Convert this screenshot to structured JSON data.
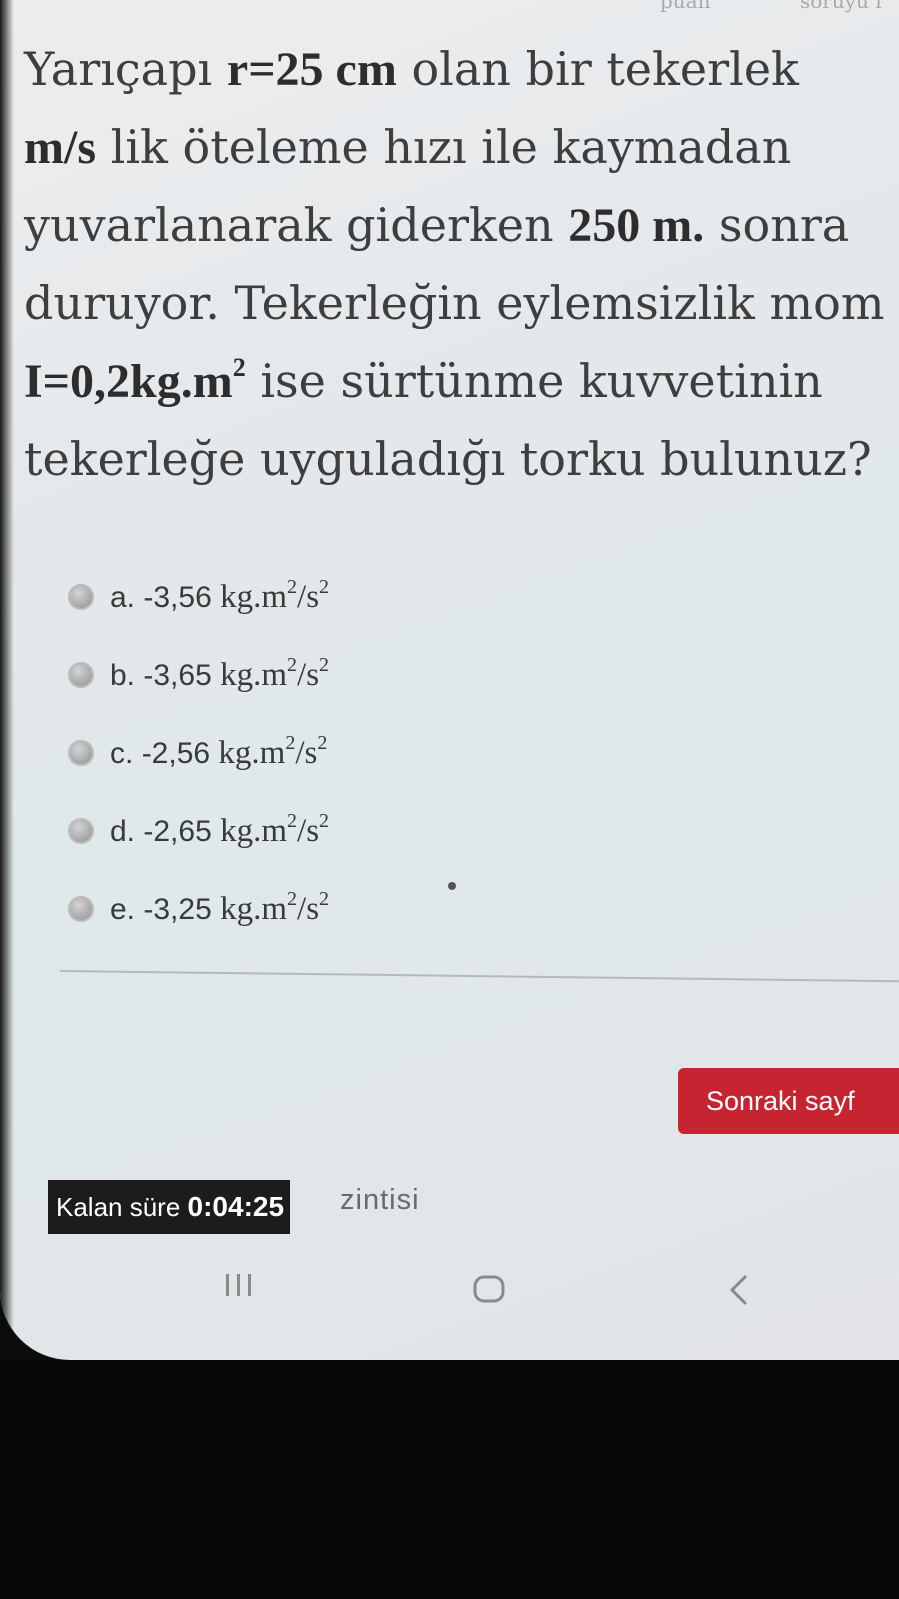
{
  "top_strip": {
    "left_fragment": "...",
    "points_fragment": "puan",
    "question_fragment": "soruyu i"
  },
  "question": {
    "line1_a": "Yarıçapı ",
    "line1_b": "r=25 cm",
    "line1_c": " olan bir tekerlek",
    "line2_a": "m/s",
    "line2_b": " lik öteleme hızı ile kaymadan",
    "line3_a": "yuvarlanarak giderken ",
    "line3_b": "250 m.",
    "line3_c": " sonra",
    "line4": "duruyor. Tekerleğin eylemsizlik mom",
    "line5_a": "I=0,2kg.m",
    "line5_sup": "2",
    "line5_b": " ise sürtünme kuvvetinin",
    "line6": "tekerleğe uyguladığı torku bulunuz?"
  },
  "options": [
    {
      "letter": "a.",
      "value": "-3,56",
      "unit": "kg.m",
      "sup1": "2",
      "per": "/s",
      "sup2": "2"
    },
    {
      "letter": "b.",
      "value": "-3,65",
      "unit": "kg.m",
      "sup1": "2",
      "per": "/s",
      "sup2": "2"
    },
    {
      "letter": "c.",
      "value": "-2,56",
      "unit": "kg.m",
      "sup1": "2",
      "per": "/s",
      "sup2": "2"
    },
    {
      "letter": "d.",
      "value": "-2,65",
      "unit": "kg.m",
      "sup1": "2",
      "per": "/s",
      "sup2": "2"
    },
    {
      "letter": "e.",
      "value": "-3,25",
      "unit": "kg.m",
      "sup1": "2",
      "per": "/s",
      "sup2": "2"
    }
  ],
  "next_button": {
    "label": "Sonraki sayf"
  },
  "timer": {
    "label": "Kalan süre ",
    "value": "0:04:25"
  },
  "behind_text": "zintisi",
  "navbar": {
    "recent_icon": "recent-apps-icon",
    "home_icon": "home-icon",
    "back_icon": "back-icon"
  },
  "colors": {
    "accent": "#c62431",
    "text": "#3e3e3e",
    "timer_bg": "#1c1c1c"
  }
}
